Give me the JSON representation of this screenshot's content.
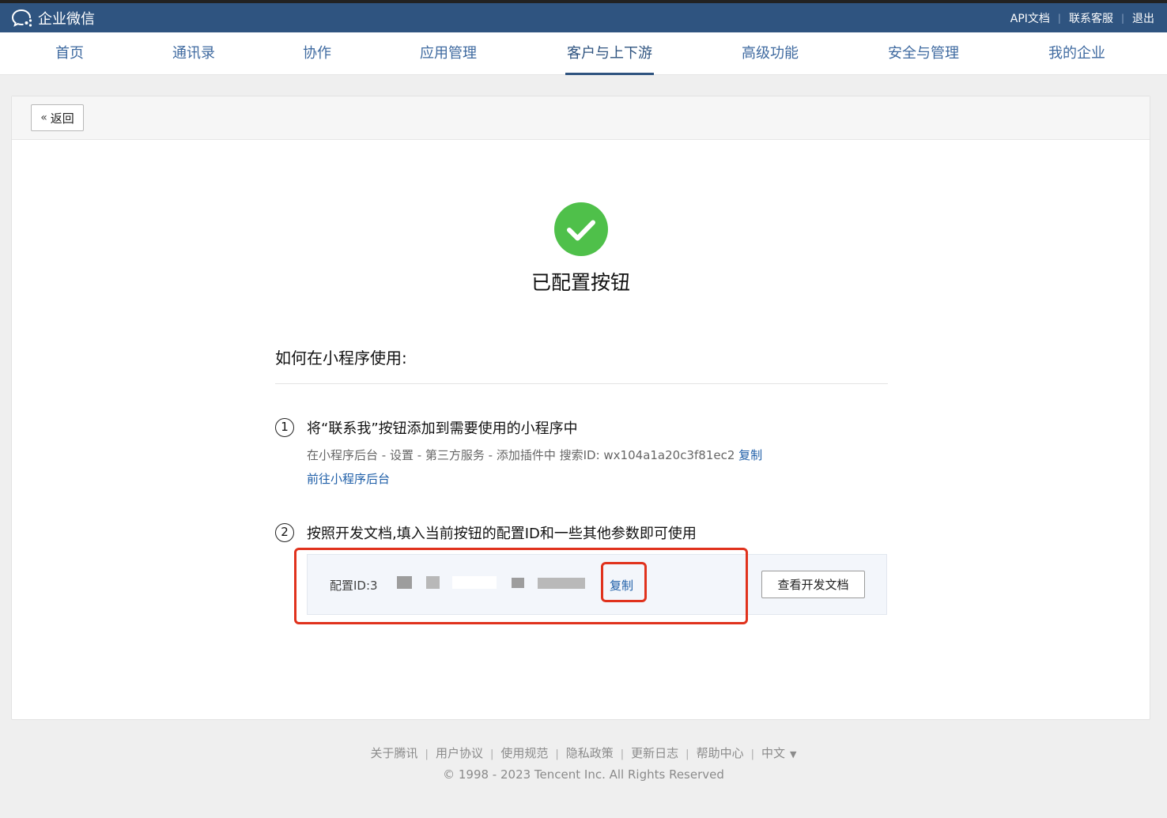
{
  "header": {
    "brand": "企业微信",
    "links": [
      "API文档",
      "联系客服",
      "退出"
    ]
  },
  "nav": {
    "items": [
      "首页",
      "通讯录",
      "协作",
      "应用管理",
      "客户与上下游",
      "高级功能",
      "安全与管理",
      "我的企业"
    ],
    "active": "客户与上下游"
  },
  "back_label": "返回",
  "success": {
    "title": "已配置按钮",
    "icon_color": "#4fc04a"
  },
  "howto": {
    "title": "如何在小程序使用:",
    "step1": {
      "number": "1",
      "title": "将“联系我”按钮添加到需要使用的小程序中",
      "desc": "在小程序后台 - 设置 - 第三方服务 - 添加插件中 搜索ID: wx104a1a20c3f81ec2",
      "copy": "复制",
      "link": "前往小程序后台"
    },
    "step2": {
      "number": "2",
      "title": "按照开发文档,填入当前按钮的配置ID和一些其他参数即可使用",
      "config_label": "配置ID:3",
      "copy": "复制",
      "doc_button": "查看开发文档"
    }
  },
  "footer": {
    "links": [
      "关于腾讯",
      "用户协议",
      "使用规范",
      "隐私政策",
      "更新日志",
      "帮助中心",
      "中文"
    ],
    "copyright": "© 1998 - 2023 Tencent Inc. All Rights Reserved"
  },
  "colors": {
    "topbar": "#2f5480",
    "link": "#1f5fa8",
    "highlight": "#e0321d"
  }
}
